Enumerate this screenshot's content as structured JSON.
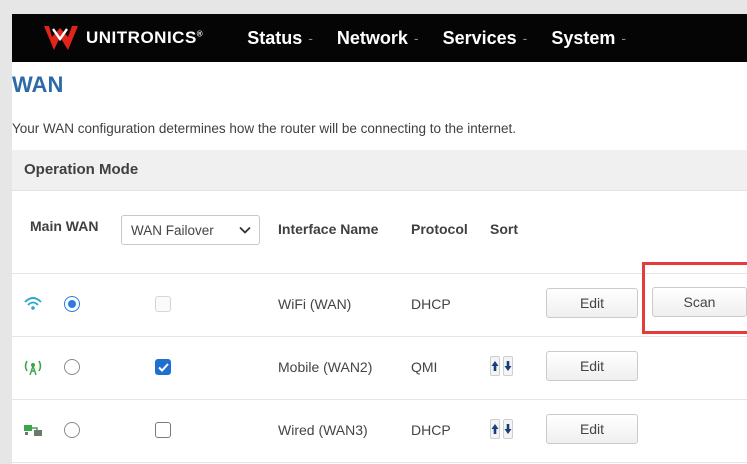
{
  "app": {
    "brand": "UNITRONICS",
    "brand_mark": "®"
  },
  "nav": {
    "items": [
      {
        "label": "Status"
      },
      {
        "label": "Network"
      },
      {
        "label": "Services"
      },
      {
        "label": "System"
      }
    ],
    "caret": "-"
  },
  "page": {
    "title": "WAN",
    "description": "Your WAN configuration determines how the router will be connecting to the internet."
  },
  "section": {
    "title": "Operation Mode"
  },
  "table": {
    "headers": {
      "main_wan": "Main WAN",
      "interface_name": "Interface Name",
      "protocol": "Protocol",
      "sort": "Sort"
    },
    "mode_select": {
      "selected": "WAN Failover"
    },
    "rows": [
      {
        "icon": "wifi-icon",
        "interface": "WiFi (WAN)",
        "protocol": "DHCP",
        "main_selected": true,
        "enabled": false,
        "enabled_disabled": true,
        "edit_label": "Edit",
        "extra_button": "Scan"
      },
      {
        "icon": "mobile-antenna-icon",
        "interface": "Mobile (WAN2)",
        "protocol": "QMI",
        "main_selected": false,
        "enabled": true,
        "enabled_disabled": false,
        "edit_label": "Edit"
      },
      {
        "icon": "wired-ethernet-icon",
        "interface": "Wired (WAN3)",
        "protocol": "DHCP",
        "main_selected": false,
        "enabled": false,
        "enabled_disabled": false,
        "edit_label": "Edit"
      }
    ]
  },
  "colors": {
    "navbar": "#050505",
    "title": "#2f6aa8",
    "accent": "#2a7de1",
    "highlight": "#e63b3b"
  }
}
